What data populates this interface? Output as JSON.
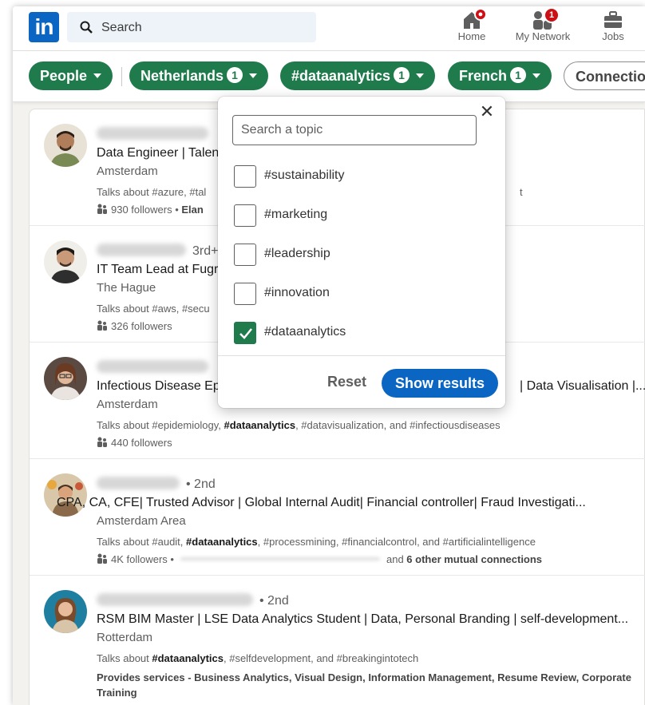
{
  "nav": {
    "logo": "in",
    "search_placeholder": "Search",
    "items": [
      {
        "label": "Home",
        "icon": "home-icon"
      },
      {
        "label": "My Network",
        "icon": "network-icon",
        "badge": "1"
      },
      {
        "label": "Jobs",
        "icon": "briefcase-icon"
      }
    ]
  },
  "filters": [
    {
      "label": "People",
      "count": null
    },
    {
      "label": "Netherlands",
      "count": "1"
    },
    {
      "label": "#dataanalytics",
      "count": "1"
    },
    {
      "label": "French",
      "count": "1"
    },
    {
      "label": "Connectio"
    }
  ],
  "dropdown": {
    "search_placeholder": "Search a topic",
    "close": "✕",
    "options": [
      {
        "label": "#sustainability",
        "checked": false
      },
      {
        "label": "#marketing",
        "checked": false
      },
      {
        "label": "#leadership",
        "checked": false
      },
      {
        "label": "#innovation",
        "checked": false
      },
      {
        "label": "#dataanalytics",
        "checked": true
      }
    ],
    "reset": "Reset",
    "show": "Show results"
  },
  "results": [
    {
      "degree": "",
      "headline": "Data Engineer | Talen",
      "location": "Amsterdam",
      "talks_pre": "Talks about #azure, #tal",
      "talks_tail": "t",
      "followers": "930 followers •",
      "followers_extra": "Elan"
    },
    {
      "degree": "3rd+",
      "headline": "IT Team Lead at Fugr",
      "location": "The Hague",
      "talks_pre": "Talks about #aws, #secu",
      "followers": "326 followers"
    },
    {
      "degree": "",
      "headline": "Infectious Disease Ep",
      "headline_tail": "| Data Visualisation |...",
      "location": "Amsterdam",
      "talks_pre": "Talks about #epidemiology, ",
      "talks_bold": "#dataanalytics",
      "talks_post": ", #datavisualization, and #infectiousdiseases",
      "followers": "440 followers"
    },
    {
      "degree": "• 2nd",
      "headline": "CPA, CA, CFE| Trusted Advisor | Global Internal Audit| Financial controller| Fraud Investigati...",
      "location": "Amsterdam Area",
      "talks_pre": "Talks about #audit, ",
      "talks_bold": "#dataanalytics",
      "talks_post": ", #processmining, #financialcontrol, and #artificialintelligence",
      "followers": "4K followers •",
      "mutual_pre": "and ",
      "mutual_bold": "6 other mutual connections"
    },
    {
      "degree": "• 2nd",
      "headline": "RSM BIM Master | LSE Data Analytics Student | Data, Personal Branding | self-development...",
      "location": "Rotterdam",
      "talks_pre": "Talks about ",
      "talks_bold": "#dataanalytics",
      "talks_post": ", #selfdevelopment, and #breakingintotech",
      "services": "Provides services - Business Analytics, Visual Design, Information Management, Resume Review, Corporate Training"
    }
  ],
  "colors": {
    "brand": "#0a66c2",
    "filter_green": "#1f7a4c",
    "badge_red": "#cc1016"
  }
}
